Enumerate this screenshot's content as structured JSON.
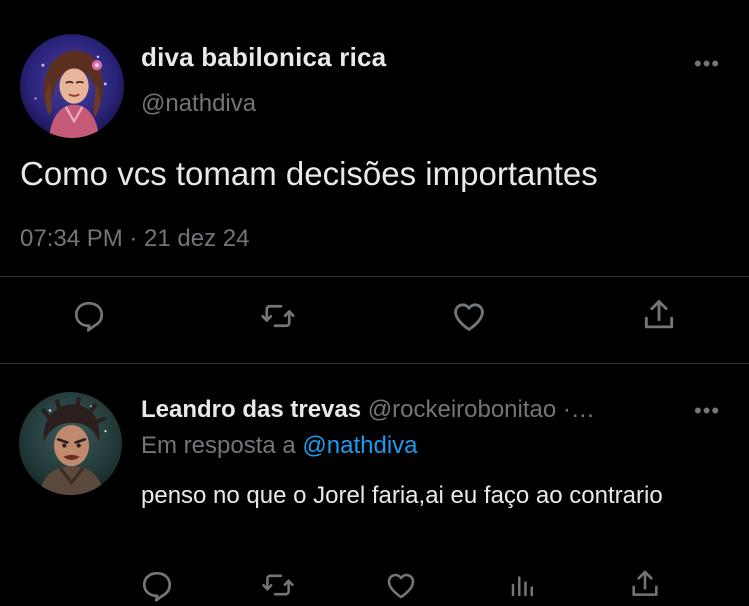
{
  "colors": {
    "background": "#000000",
    "text_primary": "#e7e9ea",
    "text_secondary": "#71767b",
    "link": "#1d9bf0",
    "divider": "#2f3336"
  },
  "main_tweet": {
    "display_name": "diva babilonica rica",
    "handle": "@nathdiva",
    "more_label": "•••",
    "text": "Como vcs tomam decisões importantes",
    "meta": "07:34 PM · 21 dez 24",
    "actions": [
      "reply-icon",
      "retweet-icon",
      "like-icon",
      "share-icon"
    ]
  },
  "reply": {
    "display_name": "Leandro das trevas",
    "handle": "@rockeirobonitao ·…",
    "more_label": "•••",
    "context_prefix": "Em resposta a ",
    "context_mention": "@nathdiva",
    "text": "penso no que o Jorel faria,ai eu faço ao contrario",
    "actions": [
      "reply-icon",
      "retweet-icon",
      "like-icon",
      "views-icon",
      "share-icon"
    ]
  }
}
